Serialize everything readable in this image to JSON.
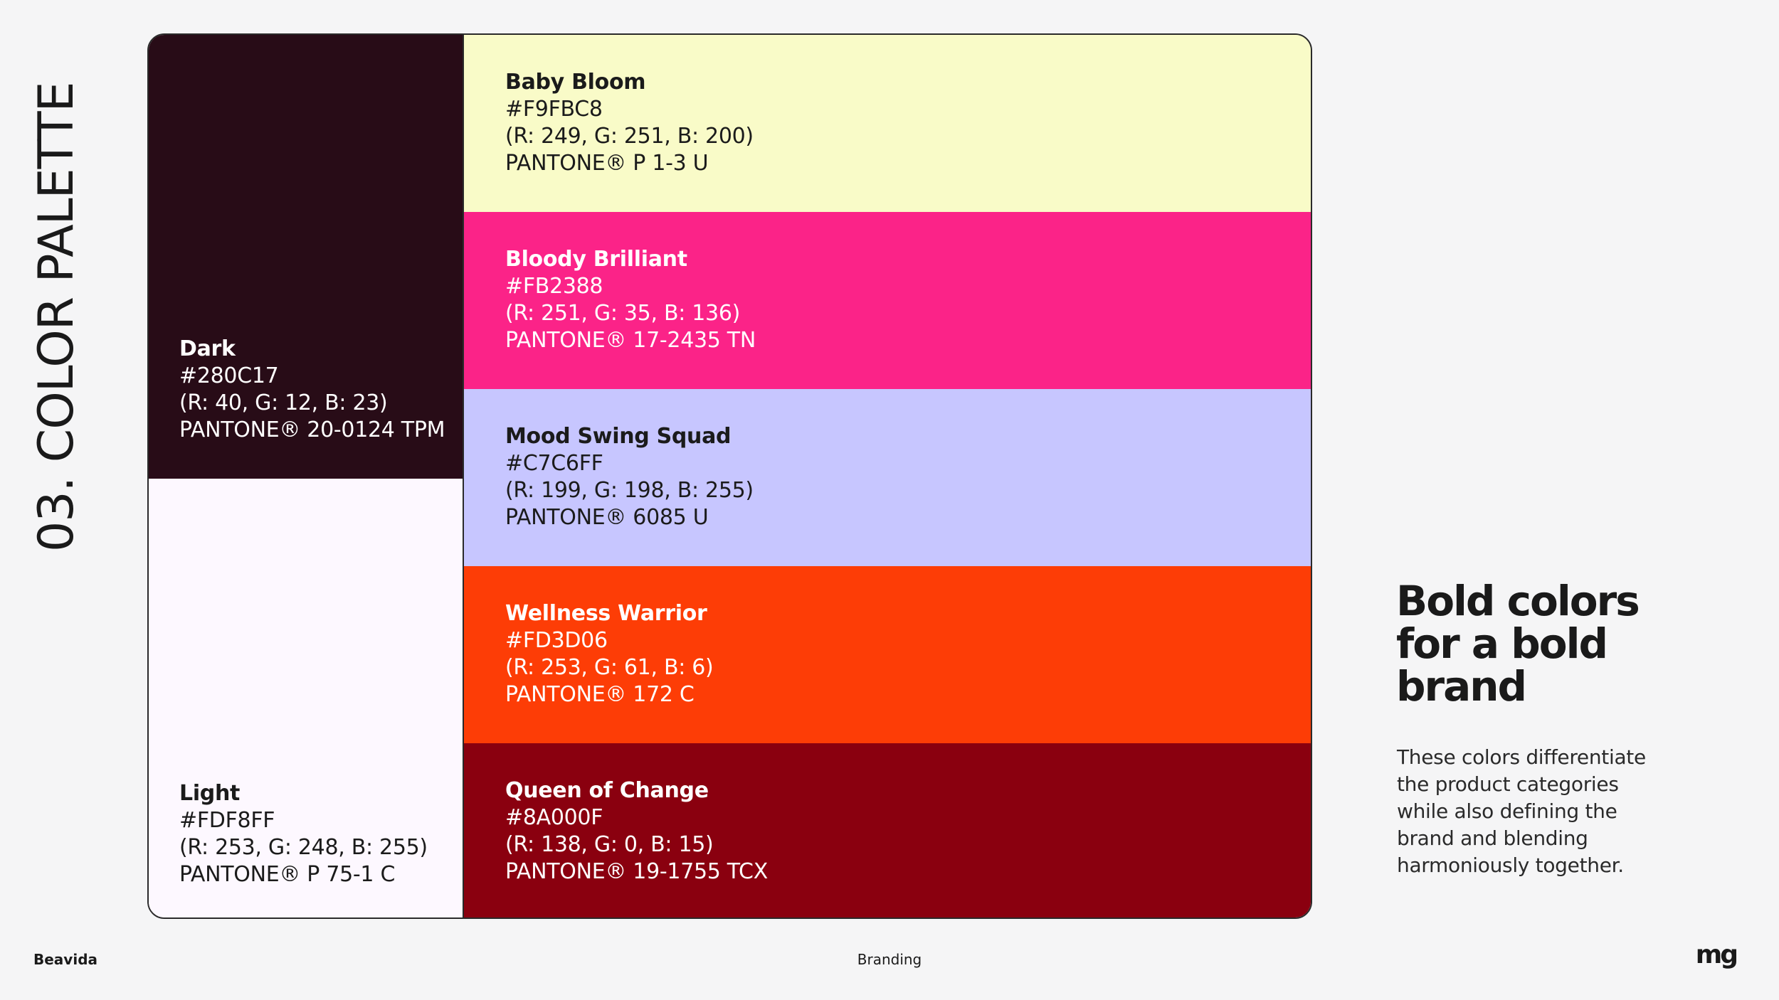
{
  "section_title": "03. COLOR PALETTE",
  "palette": {
    "dark": {
      "name": "Dark",
      "hex": "#280C17",
      "rgb": "(R: 40, G: 12, B: 23)",
      "pantone": "PANTONE® 20-0124 TPM",
      "color": "#280c17"
    },
    "light": {
      "name": "Light",
      "hex": "#FDF8FF",
      "rgb": "(R: 253, G: 248, B: 255)",
      "pantone": "PANTONE® P 75-1 C",
      "color": "#fdf8ff"
    },
    "swatches": [
      {
        "name": "Baby Bloom",
        "hex": "#F9FBC8",
        "rgb": "(R: 249, G: 251, B: 200)",
        "pantone": "PANTONE® P 1-3 U",
        "color": "#f9fbc8",
        "text_color": "#1b1b1b"
      },
      {
        "name": "Bloody Brilliant",
        "hex": "#FB2388",
        "rgb": "(R: 251, G: 35, B: 136)",
        "pantone": "PANTONE® 17-2435 TN",
        "color": "#fb2388",
        "text_color": "#ffffff"
      },
      {
        "name": "Mood Swing Squad",
        "hex": "#C7C6FF",
        "rgb": "(R: 199, G: 198, B: 255)",
        "pantone": "PANTONE® 6085 U",
        "color": "#c7c6ff",
        "text_color": "#1b1b1b"
      },
      {
        "name": "Wellness Warrior",
        "hex": "#FD3D06",
        "rgb": "(R: 253, G: 61, B: 6)",
        "pantone": "PANTONE® 172 C",
        "color": "#fd3d06",
        "text_color": "#ffffff"
      },
      {
        "name": "Queen of Change",
        "hex": "#8A000F",
        "rgb": "(R: 138, G: 0, B: 15)",
        "pantone": "PANTONE® 19-1755 TCX",
        "color": "#8a000f",
        "text_color": "#ffffff"
      }
    ]
  },
  "headline": {
    "lines": [
      "Bold colors",
      "for a bold",
      "brand"
    ]
  },
  "description": {
    "lines": [
      "These colors differentiate",
      "the product categories",
      "while also defining the",
      "brand and blending",
      "harmoniously together."
    ]
  },
  "footer": {
    "brand": "Beavida",
    "section": "Branding",
    "logo": "mg"
  }
}
